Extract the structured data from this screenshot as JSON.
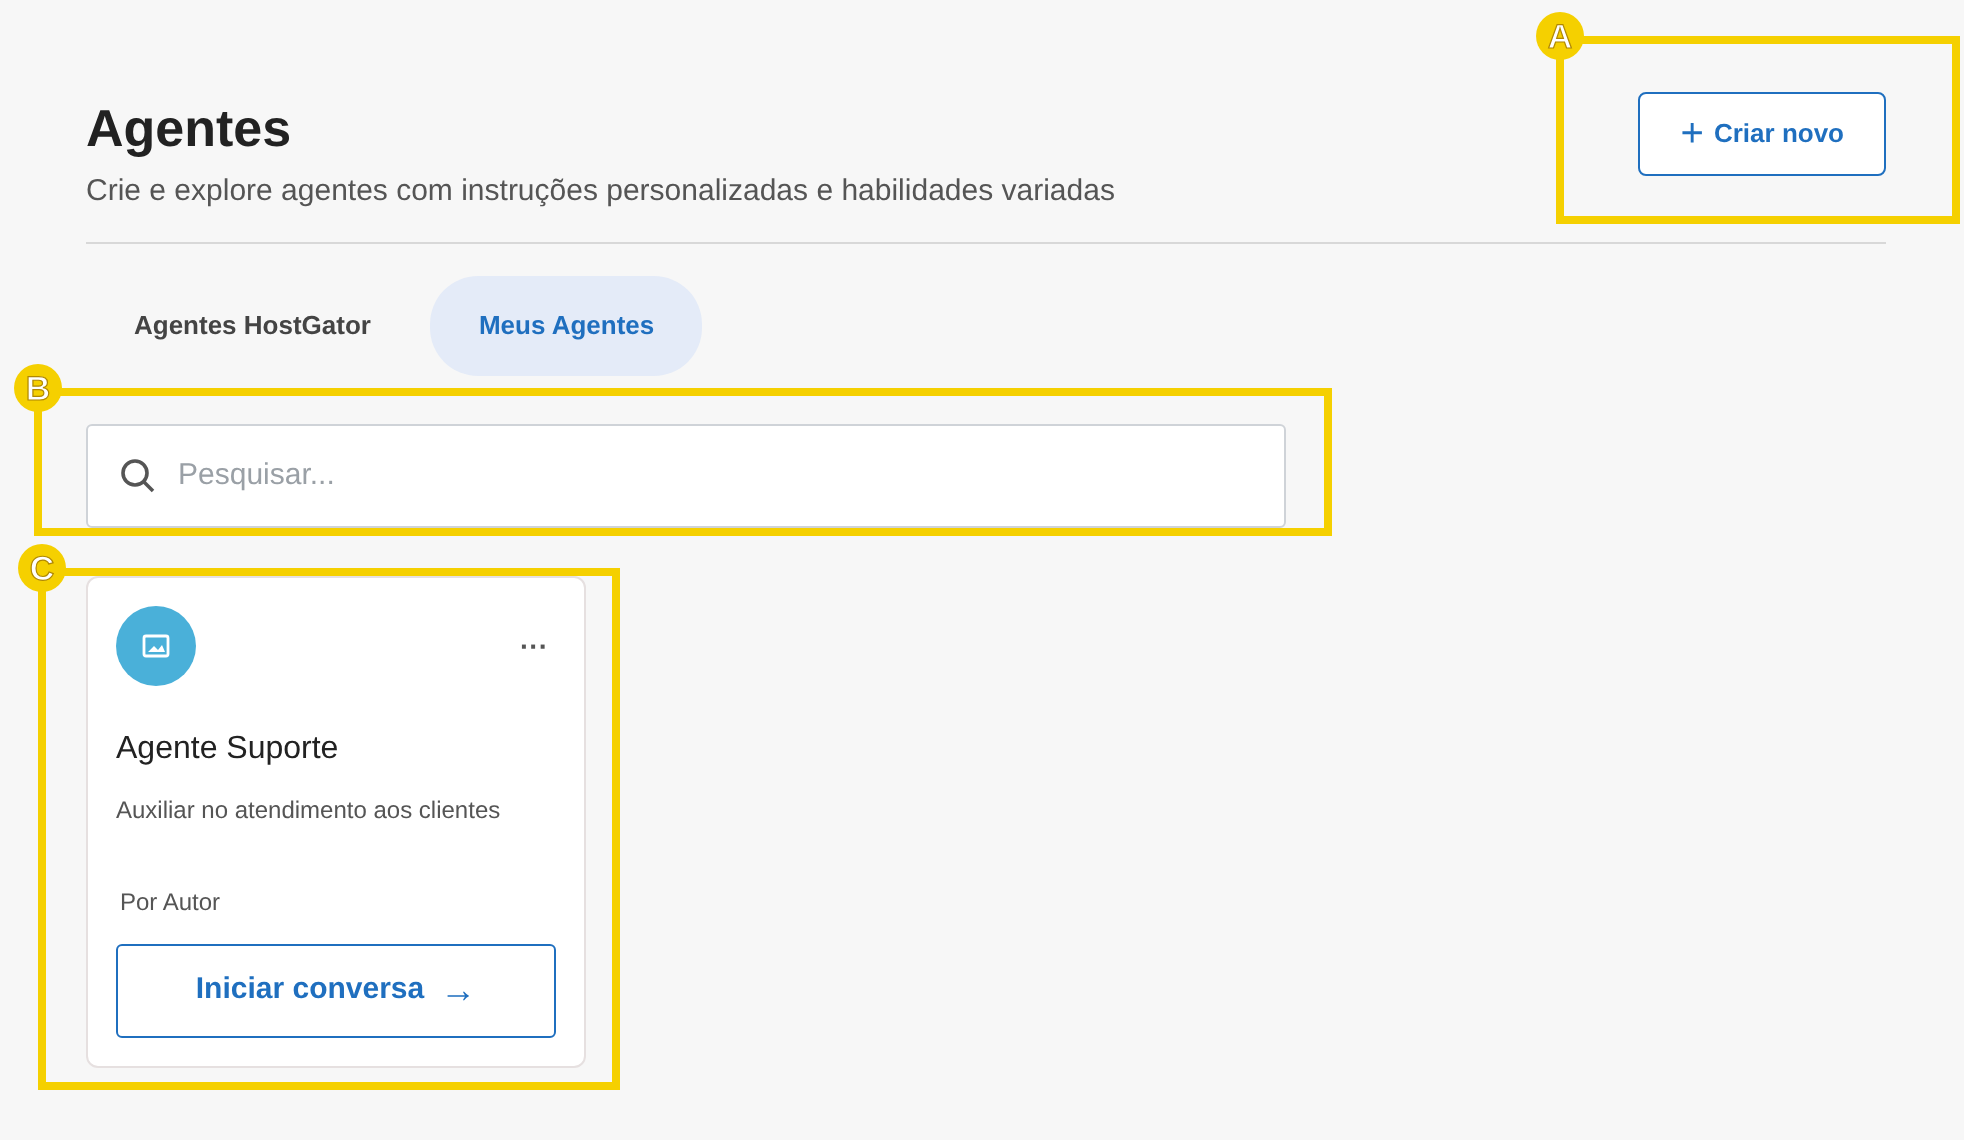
{
  "header": {
    "title": "Agentes",
    "subtitle": "Crie e explore agentes com instruções personalizadas e habilidades variadas",
    "create_button": {
      "icon": "+",
      "label": "Criar novo"
    }
  },
  "tabs": [
    {
      "label": "Agentes HostGator",
      "selected": false
    },
    {
      "label": "Meus Agentes",
      "selected": true
    }
  ],
  "search": {
    "placeholder": "Pesquisar..."
  },
  "agents": [
    {
      "name": "Agente Suporte",
      "description": "Auxiliar no atendimento aos clientes",
      "author": "Por Autor",
      "menu": "···",
      "action": {
        "label": "Iniciar conversa",
        "icon": "→"
      }
    }
  ],
  "annotations": [
    {
      "label": "A"
    },
    {
      "label": "B"
    },
    {
      "label": "C"
    }
  ]
}
